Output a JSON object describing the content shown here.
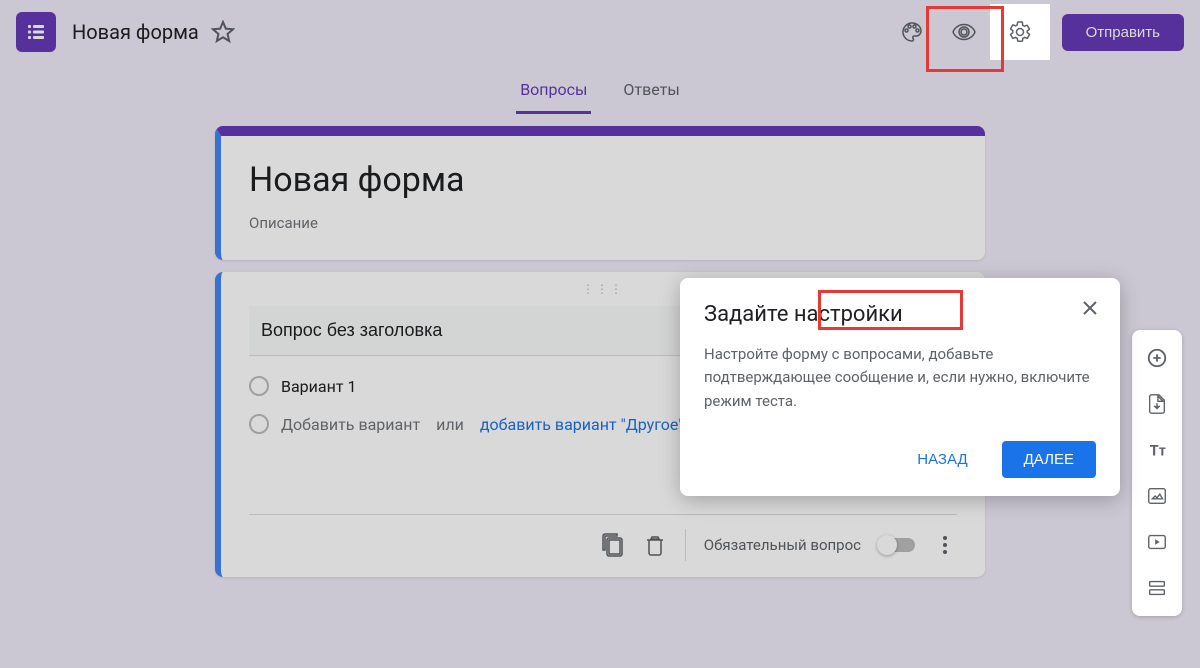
{
  "header": {
    "form_title": "Новая форма",
    "send_label": "Отправить"
  },
  "tabs": {
    "questions": "Вопросы",
    "answers": "Ответы"
  },
  "title_card": {
    "title": "Новая форма",
    "description": "Описание"
  },
  "question_card": {
    "question_text": "Вопрос без заголовка",
    "options": [
      "Вариант 1"
    ],
    "add_option": "Добавить вариант",
    "or_text": "или",
    "add_other": "добавить вариант \"Другое\"",
    "required_label": "Обязательный вопрос"
  },
  "popup": {
    "title": "Задайте настройки",
    "body": "Настройте форму с вопросами, добавьте подтверждающее сообщение и, если нужно, включите режим теста.",
    "back": "НАЗАД",
    "next": "ДАЛЕЕ"
  },
  "side_toolbar": {
    "items": [
      "add-question",
      "import-questions",
      "add-title",
      "add-image",
      "add-video",
      "add-section"
    ]
  }
}
